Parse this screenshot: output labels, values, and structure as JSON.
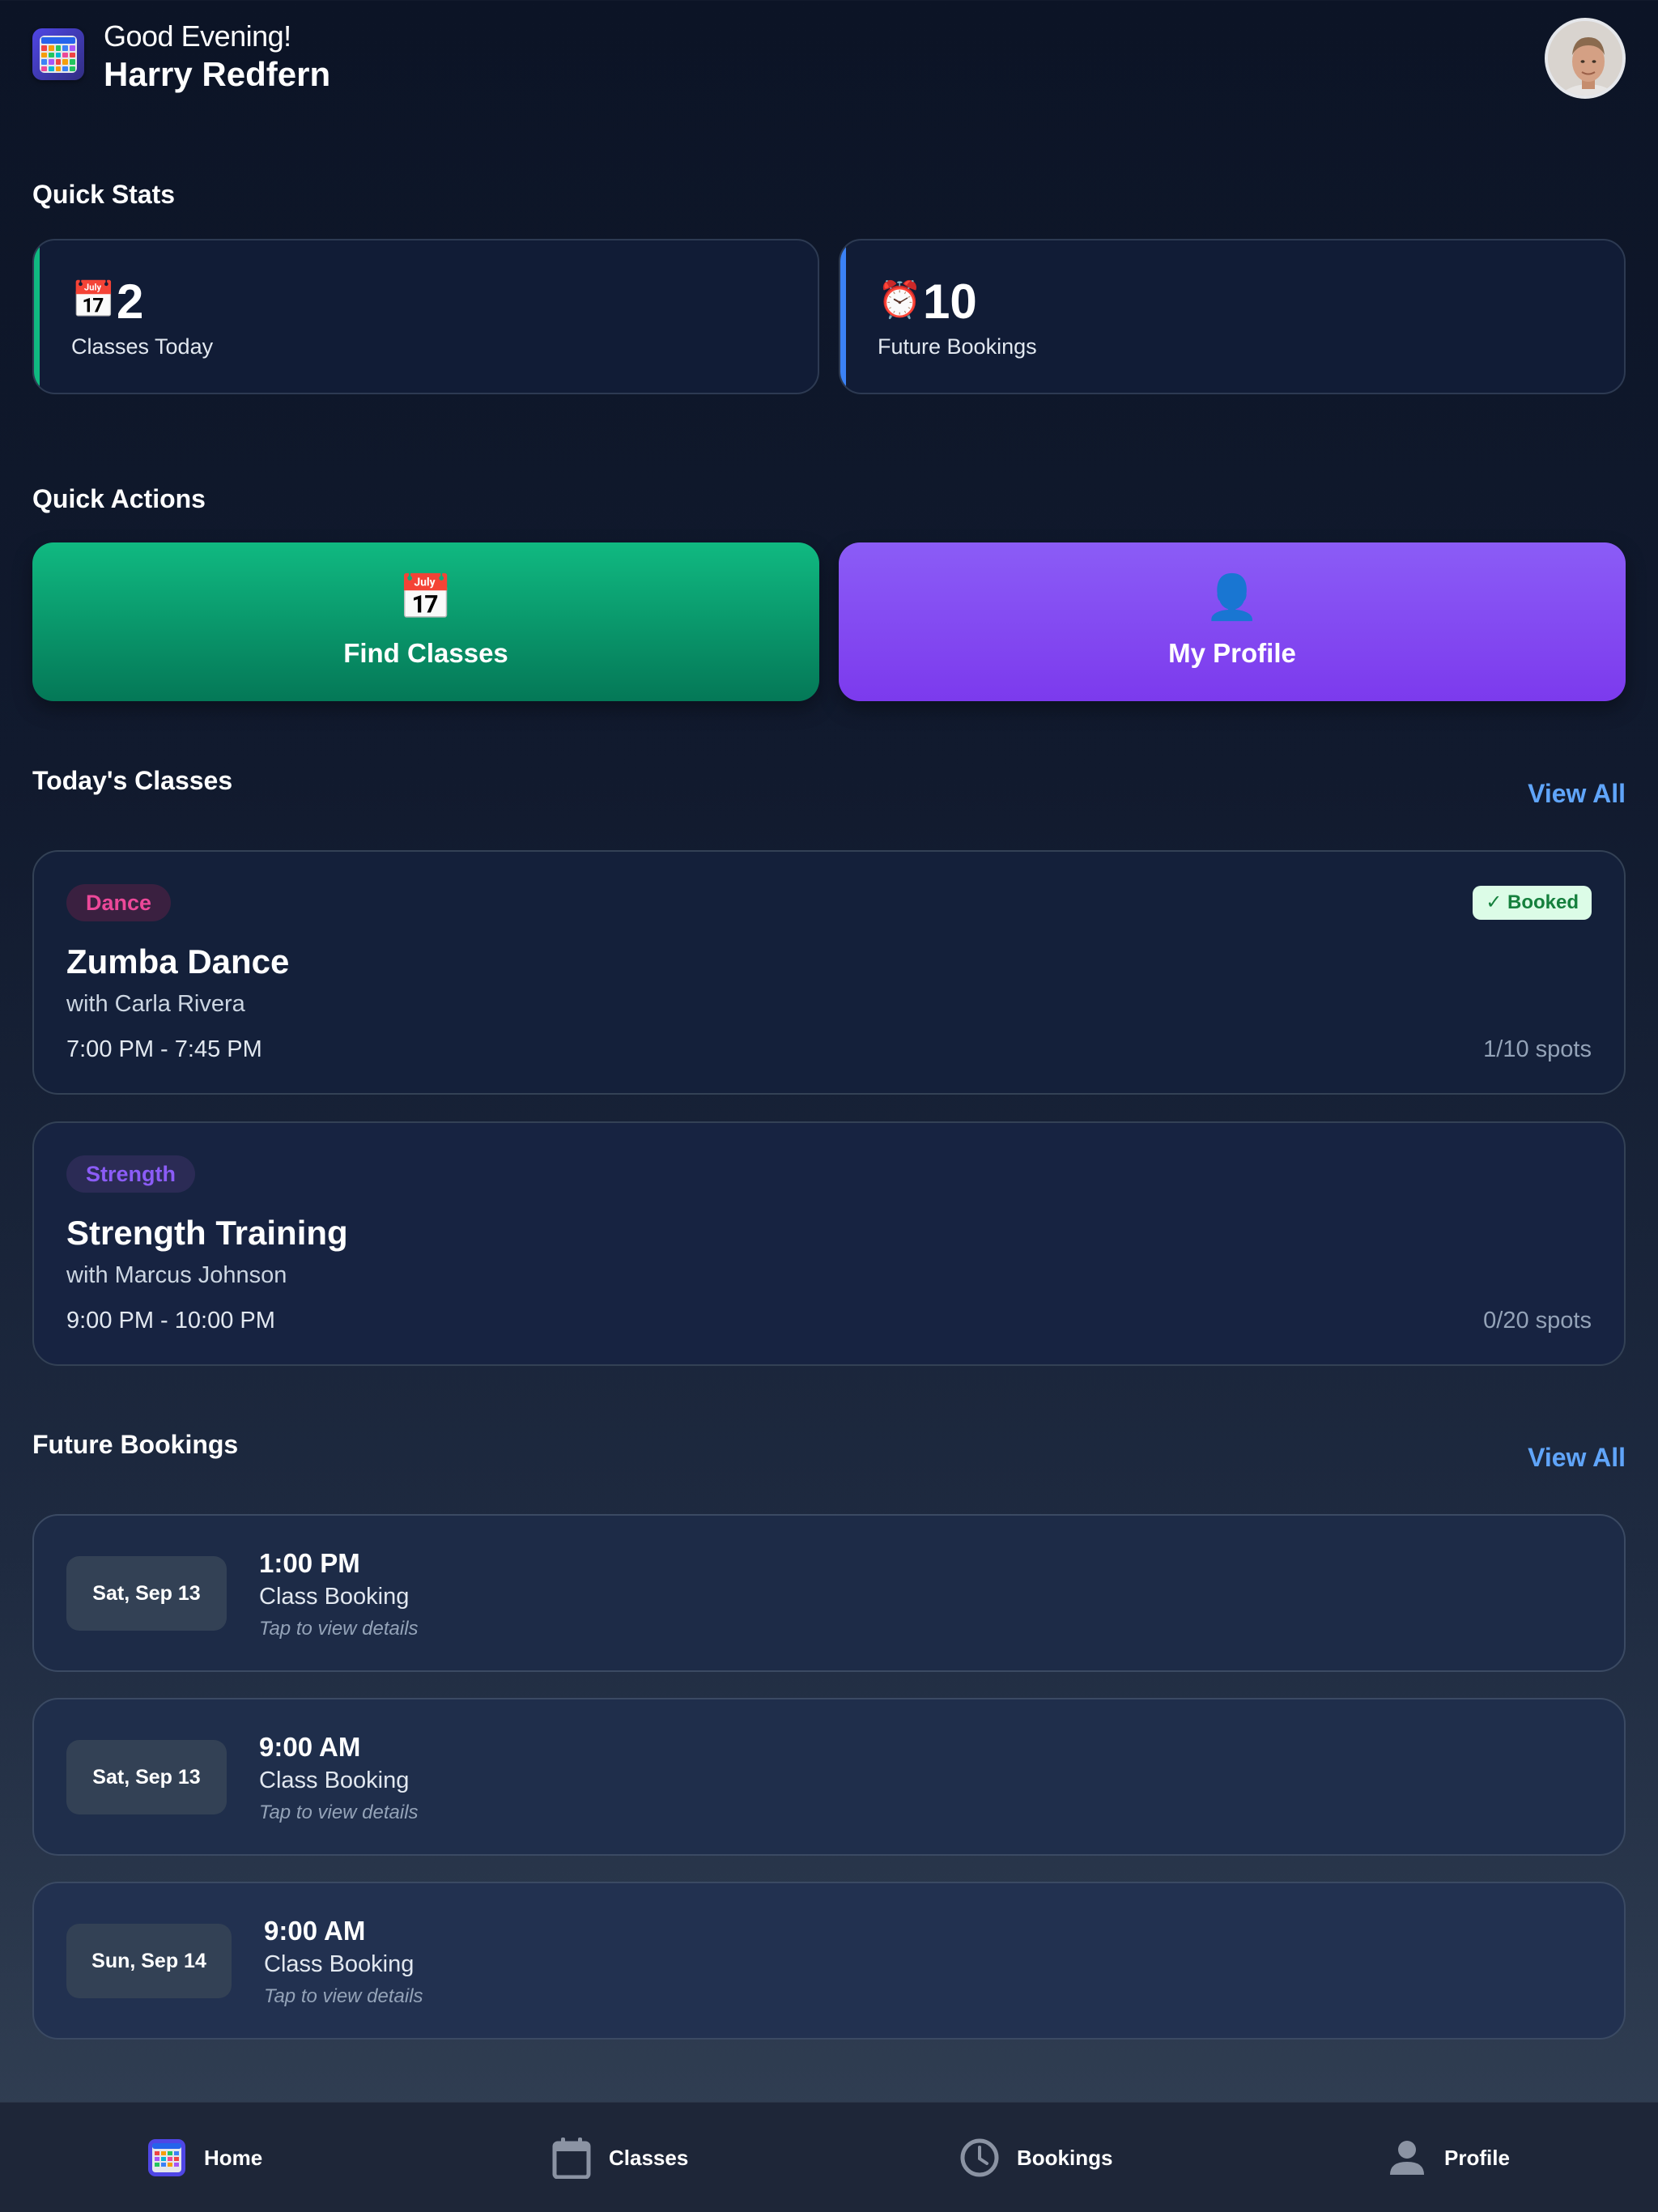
{
  "header": {
    "greeting": "Good Evening!",
    "user_name": "Harry Redfern"
  },
  "quick_stats": {
    "title": "Quick Stats",
    "items": [
      {
        "icon": "calendar-icon",
        "value": "2",
        "label": "Classes Today",
        "accent": "#10b981"
      },
      {
        "icon": "alarm-clock-icon",
        "value": "10",
        "label": "Future Bookings",
        "accent": "#3b82f6"
      }
    ]
  },
  "quick_actions": {
    "title": "Quick Actions",
    "items": [
      {
        "icon": "calendar-icon",
        "label": "Find Classes",
        "color": "#10b981"
      },
      {
        "icon": "user-silhouette-icon",
        "label": "My Profile",
        "color": "#8b5cf6"
      }
    ]
  },
  "todays_classes": {
    "title": "Today's Classes",
    "view_all": "View All",
    "items": [
      {
        "category": "Dance",
        "category_color": "#ec4899",
        "status": "✓ Booked",
        "title": "Zumba Dance",
        "instructor": "with Carla Rivera",
        "time": "7:00 PM - 7:45 PM",
        "spots": "1/10 spots"
      },
      {
        "category": "Strength",
        "category_color": "#8b5cf6",
        "title": "Strength Training",
        "instructor": "with Marcus Johnson",
        "time": "9:00 PM - 10:00 PM",
        "spots": "0/20 spots"
      }
    ]
  },
  "future_bookings": {
    "title": "Future Bookings",
    "view_all": "View All",
    "items": [
      {
        "date": "Sat, Sep 13",
        "time": "1:00 PM",
        "type": "Class Booking",
        "hint": "Tap to view details"
      },
      {
        "date": "Sat, Sep 13",
        "time": "9:00 AM",
        "type": "Class Booking",
        "hint": "Tap to view details"
      },
      {
        "date": "Sun, Sep 14",
        "time": "9:00 AM",
        "type": "Class Booking",
        "hint": "Tap to view details"
      }
    ]
  },
  "bottom_nav": {
    "items": [
      {
        "icon": "app-calendar-icon",
        "label": "Home"
      },
      {
        "icon": "calendar-icon",
        "label": "Classes"
      },
      {
        "icon": "clock-icon",
        "label": "Bookings"
      },
      {
        "icon": "person-icon",
        "label": "Profile"
      }
    ]
  },
  "colors": {
    "background": "#0c1426",
    "link": "#60a5fa",
    "booked_badge": "#dcfce7"
  }
}
